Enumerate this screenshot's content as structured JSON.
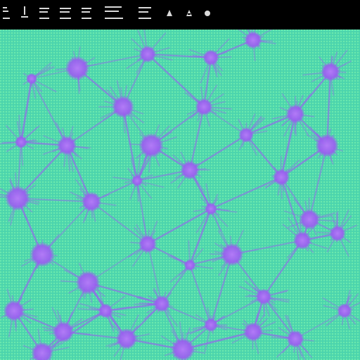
{
  "colors": {
    "background": "#000000",
    "toolbar_text": "#d9d9d9",
    "field_green": "#5fe0a0",
    "field_cyan": "#4fd0d8",
    "network_violet": "#9a5cf0",
    "node_violet": "#a36cf2"
  },
  "toolbar": {
    "text_blocks": [
      "icon-1",
      "icon-2",
      "icon-3",
      "icon-4",
      "icon-5"
    ],
    "icons": [
      "tool-icon-a",
      "tool-icon-b",
      "tool-icon-c"
    ]
  },
  "viewport": {
    "image_name": "cell-network-micrograph-icon"
  }
}
